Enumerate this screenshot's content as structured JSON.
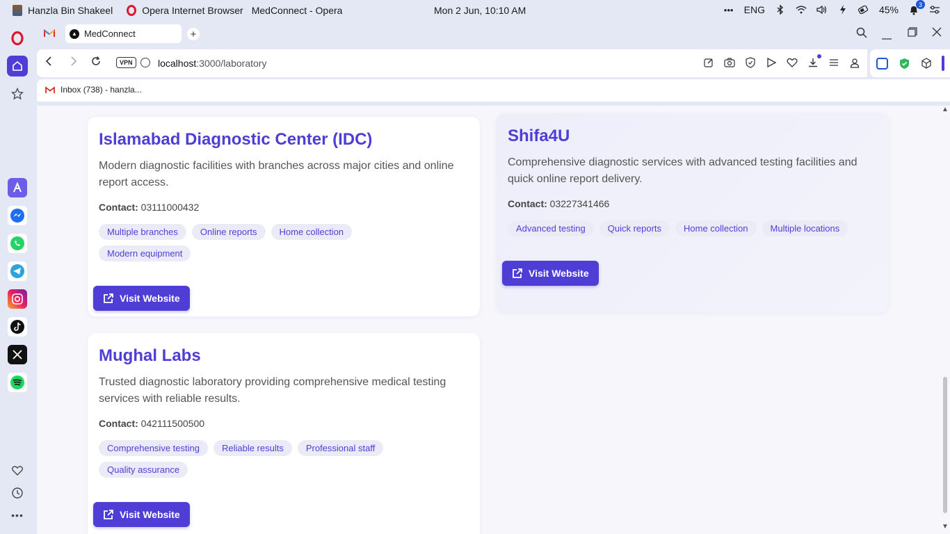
{
  "os": {
    "user": "Hanzla Bin Shakeel",
    "browser_app": "Opera Internet Browser",
    "window_title": "MedConnect - Opera",
    "datetime": "Mon 2 Jun, 10:10 AM",
    "lang": "ENG",
    "battery": "45%",
    "notifications": "3"
  },
  "tab": {
    "title": "MedConnect"
  },
  "address": {
    "host": "localhost",
    "path": ":3000/laboratory",
    "vpn": "VPN"
  },
  "bookmarks": [
    {
      "label": "Inbox (738) - hanzla..."
    }
  ],
  "labs": [
    {
      "name": "Islamabad Diagnostic Center (IDC)",
      "description": "Modern diagnostic facilities with branches across major cities and online report access.",
      "contact_label": "Contact:",
      "contact": "03111000432",
      "tags": [
        "Multiple branches",
        "Online reports",
        "Home collection",
        "Modern equipment"
      ],
      "cta": "Visit Website"
    },
    {
      "name": "Shifa4U",
      "description": "Comprehensive diagnostic services with advanced testing facilities and quick online report delivery.",
      "contact_label": "Contact:",
      "contact": "03227341466",
      "tags": [
        "Advanced testing",
        "Quick reports",
        "Home collection",
        "Multiple locations"
      ],
      "cta": "Visit Website"
    },
    {
      "name": "Mughal Labs",
      "description": "Trusted diagnostic laboratory providing comprehensive medical testing services with reliable results.",
      "contact_label": "Contact:",
      "contact": "042111500500",
      "tags": [
        "Comprehensive testing",
        "Reliable results",
        "Professional staff",
        "Quality assurance"
      ],
      "cta": "Visit Website"
    }
  ],
  "colors": {
    "accent": "#4f3ed6",
    "tag_bg": "#ebebf8",
    "chrome_bg": "#e3e8f4"
  }
}
